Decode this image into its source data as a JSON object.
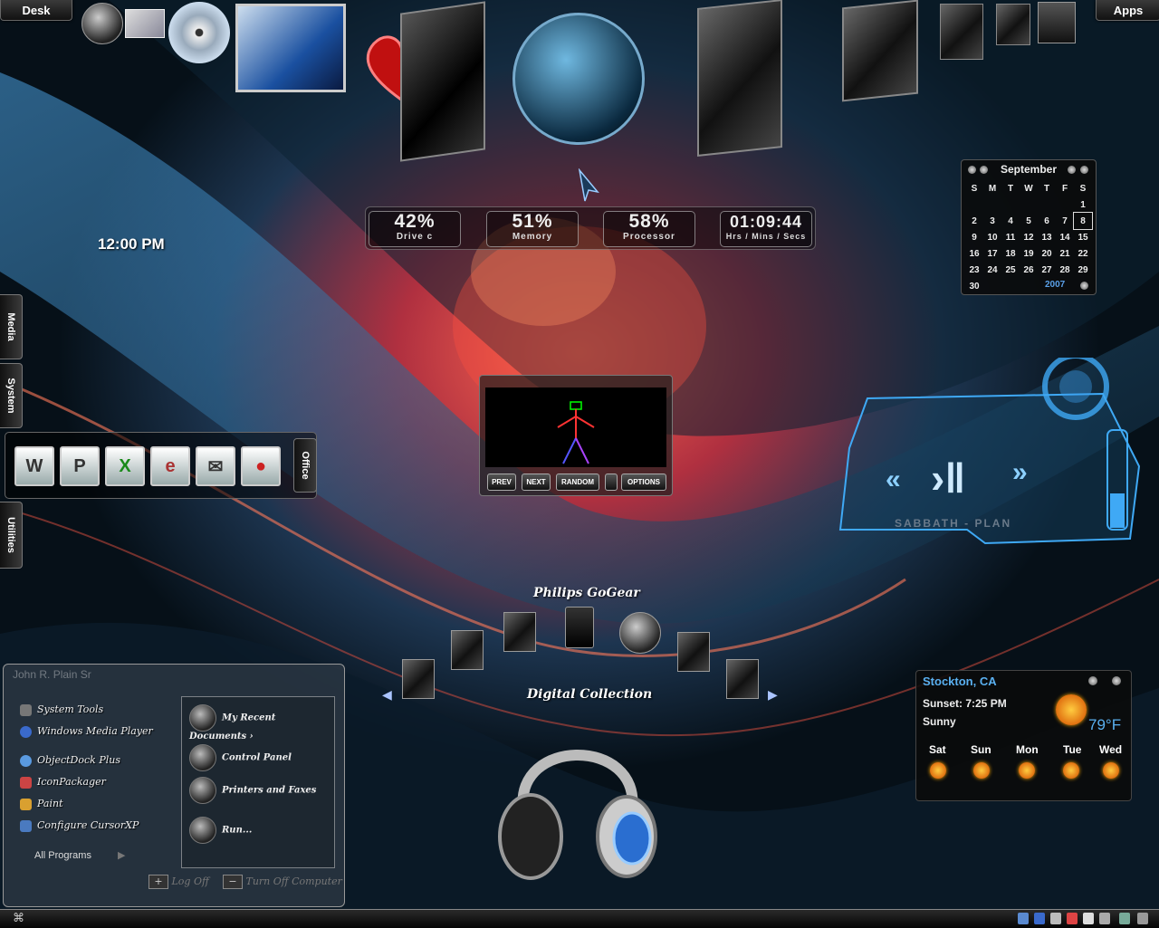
{
  "tabs": {
    "desk": "Desk",
    "apps": "Apps"
  },
  "side_tabs": {
    "media": "Media",
    "system": "System",
    "office": "Office",
    "utilities": "Utilities"
  },
  "clock": "12:00 PM",
  "stats": {
    "drive": {
      "value": "42%",
      "label": "Drive c"
    },
    "memory": {
      "value": "51%",
      "label": "Memory"
    },
    "processor": {
      "value": "58%",
      "label": "Processor"
    },
    "time": {
      "value": "01:09:44",
      "label": "Hrs / Mins / Secs"
    }
  },
  "calendar": {
    "month": "September",
    "year": "2007",
    "weekdays": [
      "S",
      "M",
      "T",
      "W",
      "T",
      "F",
      "S"
    ],
    "weeks": [
      [
        "",
        "",
        "",
        "",
        "",
        "",
        "1"
      ],
      [
        "2",
        "3",
        "4",
        "5",
        "6",
        "7",
        "8"
      ],
      [
        "9",
        "10",
        "11",
        "12",
        "13",
        "14",
        "15"
      ],
      [
        "16",
        "17",
        "18",
        "19",
        "20",
        "21",
        "22"
      ],
      [
        "23",
        "24",
        "25",
        "26",
        "27",
        "28",
        "29"
      ],
      [
        "30",
        "",
        "",
        "",
        "",
        "",
        ""
      ]
    ],
    "today": "8"
  },
  "visualizer": {
    "buttons": [
      "PREV",
      "NEXT",
      "RANDOM",
      "",
      "OPTIONS"
    ]
  },
  "music_player": {
    "track": "SABBATH - PLAN"
  },
  "dock_labels": {
    "player": "Philips GoGear",
    "collection": "Digital Collection"
  },
  "start_menu": {
    "user": "John R. Plain Sr",
    "left_items": [
      "System Tools",
      "Windows Media Player",
      "ObjectDock Plus",
      "IconPackager",
      "Paint",
      "Configure CursorXP"
    ],
    "all_programs": "All Programs",
    "right_items": [
      "My Recent Documents",
      "Control Panel",
      "Printers and Faxes",
      "Run..."
    ],
    "log_off": "Log Off",
    "turn_off": "Turn Off Computer"
  },
  "weather": {
    "city": "Stockton, CA",
    "sunset": "Sunset: 7:25 PM",
    "condition": "Sunny",
    "temp": "79°F",
    "days": [
      "Sat",
      "Sun",
      "Mon",
      "Tue",
      "Wed"
    ]
  },
  "colors": {
    "accent_blue": "#3fa9f5",
    "weather_city": "#5ab0f0"
  }
}
